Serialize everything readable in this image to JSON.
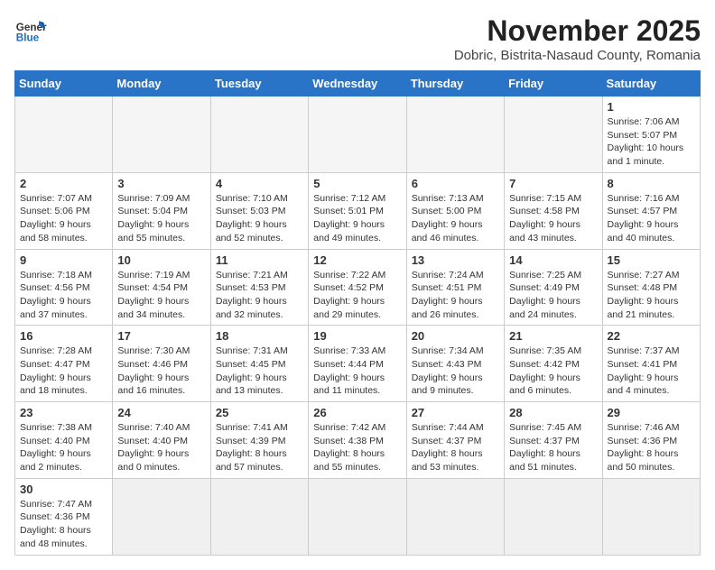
{
  "header": {
    "logo_general": "General",
    "logo_blue": "Blue",
    "month_year": "November 2025",
    "location": "Dobric, Bistrita-Nasaud County, Romania"
  },
  "weekdays": [
    "Sunday",
    "Monday",
    "Tuesday",
    "Wednesday",
    "Thursday",
    "Friday",
    "Saturday"
  ],
  "weeks": [
    [
      {
        "day": "",
        "info": ""
      },
      {
        "day": "",
        "info": ""
      },
      {
        "day": "",
        "info": ""
      },
      {
        "day": "",
        "info": ""
      },
      {
        "day": "",
        "info": ""
      },
      {
        "day": "",
        "info": ""
      },
      {
        "day": "1",
        "info": "Sunrise: 7:06 AM\nSunset: 5:07 PM\nDaylight: 10 hours and 1 minute."
      }
    ],
    [
      {
        "day": "2",
        "info": "Sunrise: 7:07 AM\nSunset: 5:06 PM\nDaylight: 9 hours and 58 minutes."
      },
      {
        "day": "3",
        "info": "Sunrise: 7:09 AM\nSunset: 5:04 PM\nDaylight: 9 hours and 55 minutes."
      },
      {
        "day": "4",
        "info": "Sunrise: 7:10 AM\nSunset: 5:03 PM\nDaylight: 9 hours and 52 minutes."
      },
      {
        "day": "5",
        "info": "Sunrise: 7:12 AM\nSunset: 5:01 PM\nDaylight: 9 hours and 49 minutes."
      },
      {
        "day": "6",
        "info": "Sunrise: 7:13 AM\nSunset: 5:00 PM\nDaylight: 9 hours and 46 minutes."
      },
      {
        "day": "7",
        "info": "Sunrise: 7:15 AM\nSunset: 4:58 PM\nDaylight: 9 hours and 43 minutes."
      },
      {
        "day": "8",
        "info": "Sunrise: 7:16 AM\nSunset: 4:57 PM\nDaylight: 9 hours and 40 minutes."
      }
    ],
    [
      {
        "day": "9",
        "info": "Sunrise: 7:18 AM\nSunset: 4:56 PM\nDaylight: 9 hours and 37 minutes."
      },
      {
        "day": "10",
        "info": "Sunrise: 7:19 AM\nSunset: 4:54 PM\nDaylight: 9 hours and 34 minutes."
      },
      {
        "day": "11",
        "info": "Sunrise: 7:21 AM\nSunset: 4:53 PM\nDaylight: 9 hours and 32 minutes."
      },
      {
        "day": "12",
        "info": "Sunrise: 7:22 AM\nSunset: 4:52 PM\nDaylight: 9 hours and 29 minutes."
      },
      {
        "day": "13",
        "info": "Sunrise: 7:24 AM\nSunset: 4:51 PM\nDaylight: 9 hours and 26 minutes."
      },
      {
        "day": "14",
        "info": "Sunrise: 7:25 AM\nSunset: 4:49 PM\nDaylight: 9 hours and 24 minutes."
      },
      {
        "day": "15",
        "info": "Sunrise: 7:27 AM\nSunset: 4:48 PM\nDaylight: 9 hours and 21 minutes."
      }
    ],
    [
      {
        "day": "16",
        "info": "Sunrise: 7:28 AM\nSunset: 4:47 PM\nDaylight: 9 hours and 18 minutes."
      },
      {
        "day": "17",
        "info": "Sunrise: 7:30 AM\nSunset: 4:46 PM\nDaylight: 9 hours and 16 minutes."
      },
      {
        "day": "18",
        "info": "Sunrise: 7:31 AM\nSunset: 4:45 PM\nDaylight: 9 hours and 13 minutes."
      },
      {
        "day": "19",
        "info": "Sunrise: 7:33 AM\nSunset: 4:44 PM\nDaylight: 9 hours and 11 minutes."
      },
      {
        "day": "20",
        "info": "Sunrise: 7:34 AM\nSunset: 4:43 PM\nDaylight: 9 hours and 9 minutes."
      },
      {
        "day": "21",
        "info": "Sunrise: 7:35 AM\nSunset: 4:42 PM\nDaylight: 9 hours and 6 minutes."
      },
      {
        "day": "22",
        "info": "Sunrise: 7:37 AM\nSunset: 4:41 PM\nDaylight: 9 hours and 4 minutes."
      }
    ],
    [
      {
        "day": "23",
        "info": "Sunrise: 7:38 AM\nSunset: 4:40 PM\nDaylight: 9 hours and 2 minutes."
      },
      {
        "day": "24",
        "info": "Sunrise: 7:40 AM\nSunset: 4:40 PM\nDaylight: 9 hours and 0 minutes."
      },
      {
        "day": "25",
        "info": "Sunrise: 7:41 AM\nSunset: 4:39 PM\nDaylight: 8 hours and 57 minutes."
      },
      {
        "day": "26",
        "info": "Sunrise: 7:42 AM\nSunset: 4:38 PM\nDaylight: 8 hours and 55 minutes."
      },
      {
        "day": "27",
        "info": "Sunrise: 7:44 AM\nSunset: 4:37 PM\nDaylight: 8 hours and 53 minutes."
      },
      {
        "day": "28",
        "info": "Sunrise: 7:45 AM\nSunset: 4:37 PM\nDaylight: 8 hours and 51 minutes."
      },
      {
        "day": "29",
        "info": "Sunrise: 7:46 AM\nSunset: 4:36 PM\nDaylight: 8 hours and 50 minutes."
      }
    ],
    [
      {
        "day": "30",
        "info": "Sunrise: 7:47 AM\nSunset: 4:36 PM\nDaylight: 8 hours and 48 minutes."
      },
      {
        "day": "",
        "info": ""
      },
      {
        "day": "",
        "info": ""
      },
      {
        "day": "",
        "info": ""
      },
      {
        "day": "",
        "info": ""
      },
      {
        "day": "",
        "info": ""
      },
      {
        "day": "",
        "info": ""
      }
    ]
  ]
}
